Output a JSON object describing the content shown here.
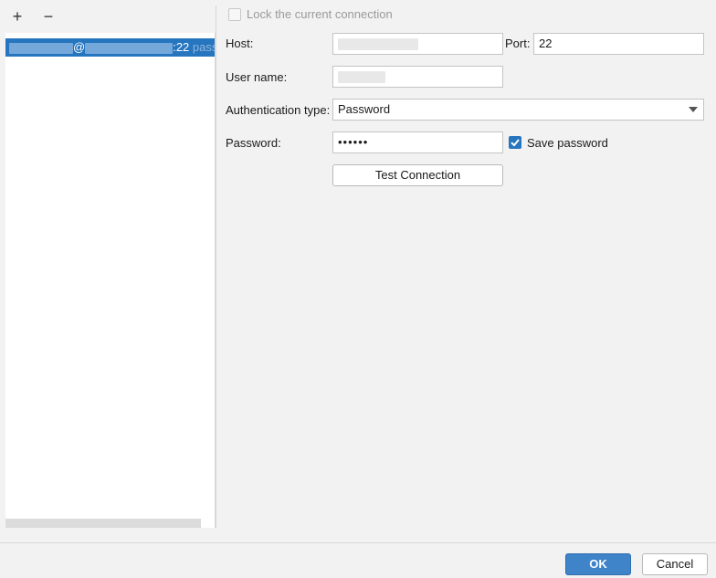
{
  "toolbar": {
    "add_label": "+",
    "remove_label": "−"
  },
  "connections": {
    "items": [
      {
        "at": "@",
        "port_suffix": ":22",
        "auth_hint": "passwo"
      }
    ]
  },
  "form": {
    "lock_label": "Lock the current connection",
    "host_label": "Host:",
    "port_label": "Port:",
    "port_value": "22",
    "username_label": "User name:",
    "auth_label": "Authentication type:",
    "auth_value": "Password",
    "password_label": "Password:",
    "password_value": "••••••",
    "save_password_label": "Save password",
    "save_password_checked": true,
    "test_connection_label": "Test Connection"
  },
  "footer": {
    "ok_label": "OK",
    "cancel_label": "Cancel"
  },
  "colors": {
    "accent": "#2675bf",
    "ok": "#3f84c8"
  }
}
